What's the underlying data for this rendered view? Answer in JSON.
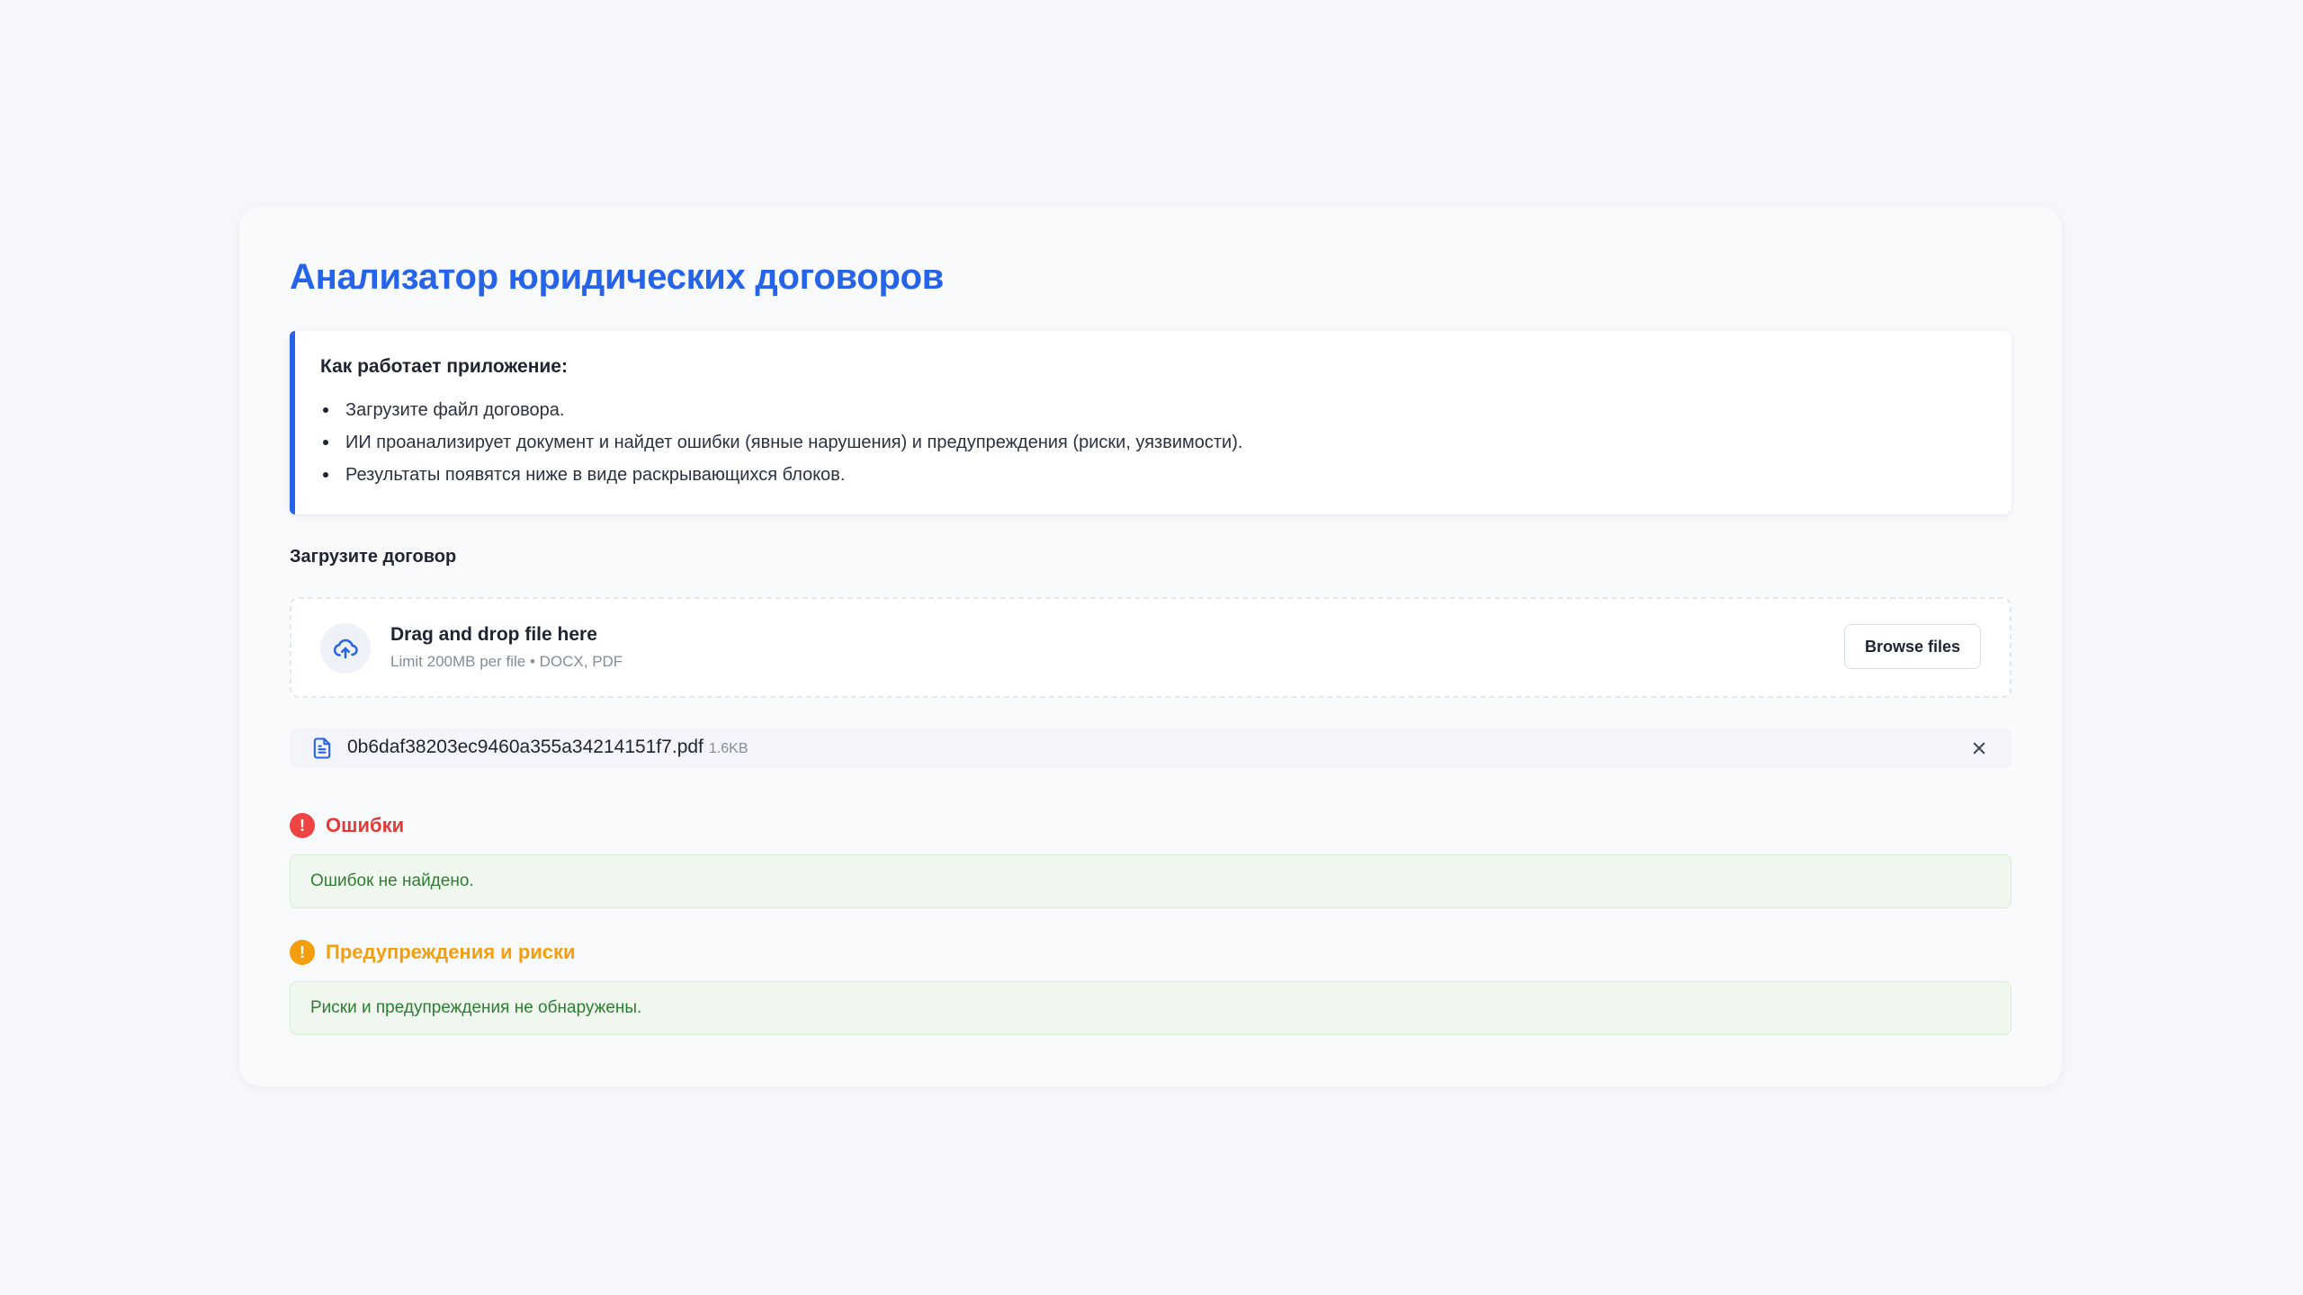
{
  "app": {
    "title": "Анализатор юридических договоров"
  },
  "info": {
    "heading": "Как работает приложение:",
    "items": [
      "Загрузите файл договора.",
      "ИИ проанализирует документ и найдет ошибки (явные нарушения) и предупреждения (риски, уязвимости).",
      "Результаты появятся ниже в виде раскрывающихся блоков."
    ]
  },
  "upload": {
    "label": "Загрузите договор",
    "drop_title": "Drag and drop file here",
    "drop_hint": "Limit 200MB per file • DOCX, PDF",
    "browse_label": "Browse files",
    "icon": "cloud-upload-icon"
  },
  "file": {
    "name": "0b6daf38203ec9460a355a34214151f7.pdf",
    "size": "1.6KB",
    "icon": "document-icon",
    "close_icon": "close-icon"
  },
  "errors": {
    "title": "Ошибки",
    "badge": "!",
    "message": "Ошибок не найдено."
  },
  "warnings": {
    "title": "Предупреждения и риски",
    "badge": "!",
    "message": "Риски и предупреждения не обнаружены."
  },
  "colors": {
    "accent": "#2563eb",
    "error": "#ef4444",
    "warning": "#f59e0b",
    "success_text": "#2e7d32",
    "success_bg": "#eff7ee"
  }
}
